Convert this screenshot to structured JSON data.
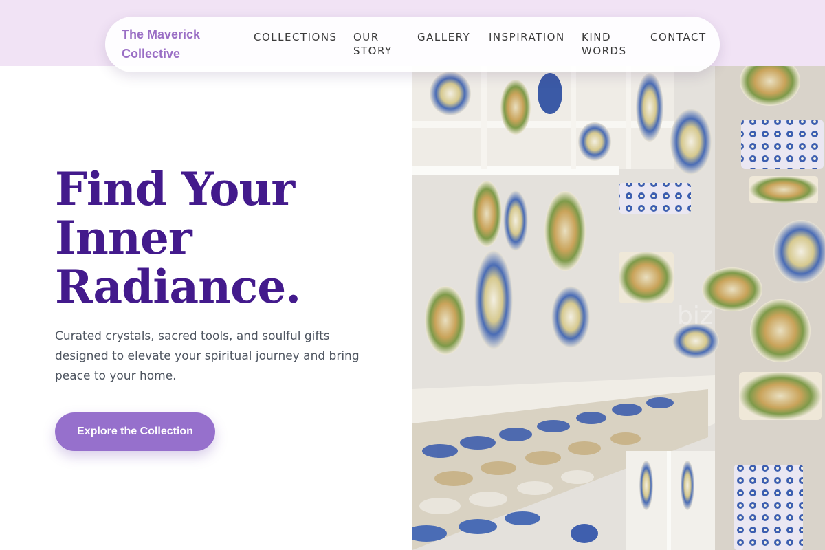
{
  "brand": {
    "name": "The Maverick Collective"
  },
  "nav": {
    "items": [
      {
        "label": "COLLECTIONS"
      },
      {
        "label": "OUR STORY"
      },
      {
        "label": "GALLERY"
      },
      {
        "label": "INSPIRATION"
      },
      {
        "label": "KIND WORDS"
      },
      {
        "label": "CONTACT"
      }
    ]
  },
  "hero": {
    "title": "Find Your Inner Radiance.",
    "subtitle": "Curated crystals, sacred tools, and soulful gifts designed to elevate your spiritual journey and bring peace to your home.",
    "cta_label": "Explore the Collection",
    "image": {
      "watermark": "biz"
    }
  },
  "colors": {
    "brand": "#9a6ec5",
    "title": "#431a8c",
    "cta": "#9670cc",
    "band": "#f1e3f5",
    "body_text": "#4e5560"
  }
}
